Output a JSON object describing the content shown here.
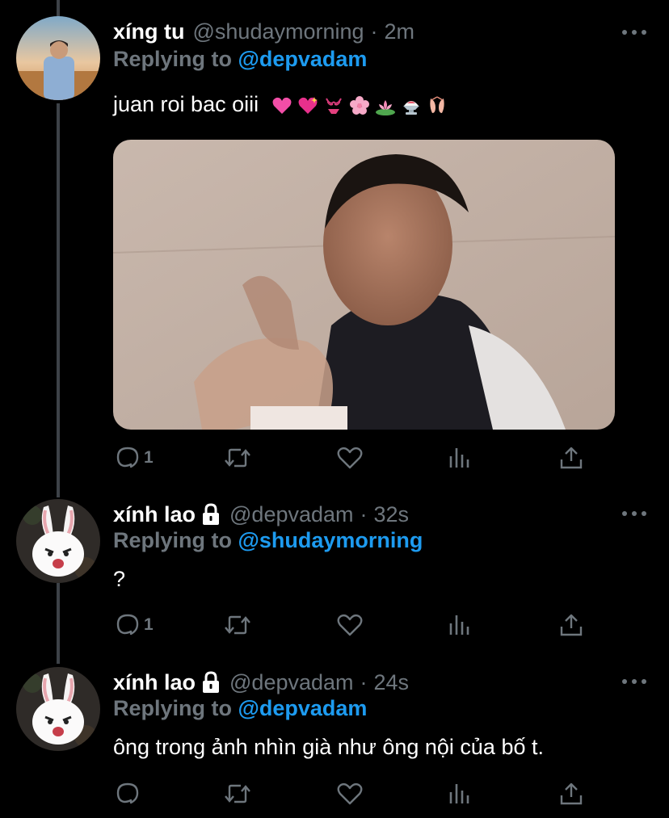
{
  "tweets": [
    {
      "name": "xíng tu",
      "handle": "@shudaymorning",
      "dot": "·",
      "time": "2m",
      "replying_prefix": "Replying to",
      "replying_to": "@depvadam",
      "text": "juan roi bac oiii",
      "emoji_icons": [
        "heart-icon",
        "sparkling-heart-icon",
        "bikini-icon",
        "cherry-blossom-icon",
        "lotus-icon",
        "shaved-ice-icon",
        "ballet-shoes-icon"
      ],
      "reply_count": "1",
      "retweet_count": "",
      "like_count": "",
      "locked": false,
      "has_media": true
    },
    {
      "name": "xính lao",
      "handle": "@depvadam",
      "dot": "·",
      "time": "32s",
      "replying_prefix": "Replying to",
      "replying_to": "@shudaymorning",
      "text": "?",
      "reply_count": "1",
      "retweet_count": "",
      "like_count": "",
      "locked": true,
      "has_media": false
    },
    {
      "name": "xính lao",
      "handle": "@depvadam",
      "dot": "·",
      "time": "24s",
      "replying_prefix": "Replying to",
      "replying_to": "@depvadam",
      "text": "ông trong ảnh nhìn già như ông nội của bố t.",
      "reply_count": "",
      "retweet_count": "",
      "like_count": "",
      "locked": true,
      "has_media": false
    }
  ],
  "colors": {
    "background": "#000000",
    "text_primary": "#ffffff",
    "text_secondary": "#6e767d",
    "link": "#1d9bf0",
    "thread_line": "#3d4248"
  }
}
